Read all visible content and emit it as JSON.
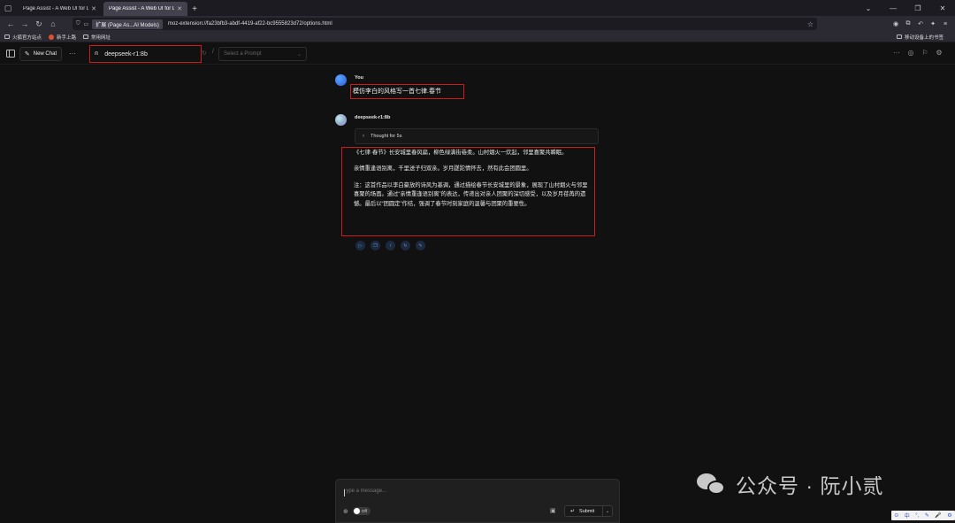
{
  "browser": {
    "tabs": [
      {
        "title": "Page Assist - A Web UI for Local",
        "active": false
      },
      {
        "title": "Page Assist - A Web UI for Local",
        "active": true
      }
    ],
    "url_chip": "扩展 (Page As...AI Models)",
    "url": "moz-extension://fa23bfb3-abdf-4419-af22-bc9555823d72/options.html",
    "bookmarks": [
      "火狐官方站点",
      "新手上路",
      "常用网址"
    ],
    "mobile_bookmarks": "移动设备上的书签"
  },
  "header": {
    "new_chat_label": "New Chat",
    "model": "deepseek-r1:8b",
    "prompt_placeholder": "Select a Prompt"
  },
  "chat": {
    "user_name": "You",
    "user_message": "模仿李白的风格写一首七律.春节",
    "bot_name": "deepseek-r1:8b",
    "thought_label": "Thought for 5s",
    "answer_paragraphs": [
      "《七律·春节》长安城里春风扁，柳色绿满街巷柔。山村烟火一炊起，邻里喜聚共瞬眠。",
      "亲情重逢语别离，千里送子归双亲。岁月蹉跎情怀去，然有此会团圆里。",
      "注：这首作品以李白豪放的诗风为基调，通过描绘春节长安城里的景象，展现了山村烟火与邻里喜聚的场面。通过“亲情重逢语别离”的表达，传递出对亲人团聚的深切感受，以及岁月荏苒的遗憾。最后以“团圆定”作结，强调了春节时刻家庭的温馨与团聚的重要性。"
    ]
  },
  "composer": {
    "placeholder": "Type a message...",
    "web_search_toggle": "Off",
    "submit_label": "Submit"
  },
  "watermark": {
    "text": "公众号 · 阮小贰"
  },
  "ime": {
    "items": [
      "中",
      "°,",
      "✎",
      "🎤",
      "⚙"
    ]
  },
  "colors": {
    "background": "#111111",
    "highlight": "#d0191a",
    "user_avatar": "#2a5bd7"
  }
}
